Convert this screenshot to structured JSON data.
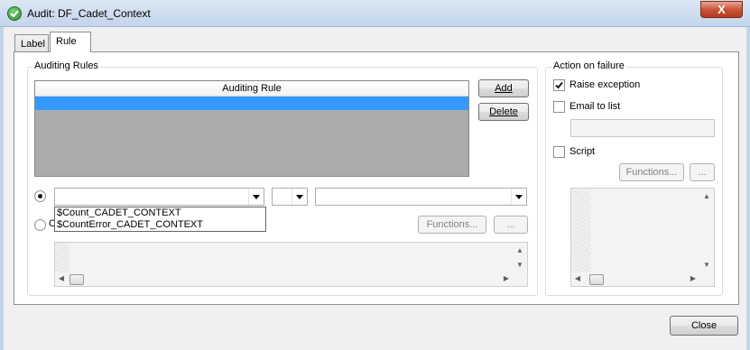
{
  "window": {
    "title": "Audit: DF_Cadet_Context",
    "close_glyph": "X"
  },
  "tabs": [
    {
      "label": "Label",
      "active": false
    },
    {
      "label": "Rule",
      "active": true
    }
  ],
  "auditing_rules": {
    "legend": "Auditing Rules",
    "grid_header": "Auditing Rule",
    "add_label": "Add",
    "delete_label": "Delete",
    "row_selected_color": "#3399ff",
    "functions_label": "Functions...",
    "ellipsis_label": "...",
    "dropdown_items": [
      "$Count_CADET_CONTEXT",
      "$CountError_CADET_CONTEXT"
    ],
    "radio1_selected": true,
    "radio2_visible_char": "C"
  },
  "action_on_failure": {
    "legend": "Action on failure",
    "raise_exception_label": "Raise exception",
    "raise_exception_checked": true,
    "email_label": "Email to list",
    "email_checked": false,
    "email_value": "",
    "script_label": "Script",
    "script_checked": false,
    "functions_label": "Functions...",
    "ellipsis_label": "..."
  },
  "footer": {
    "close_label": "Close"
  },
  "icons": {
    "title": "audit-check-icon",
    "dropdown": "chevron-down-icon",
    "check": "checkmark-icon"
  }
}
